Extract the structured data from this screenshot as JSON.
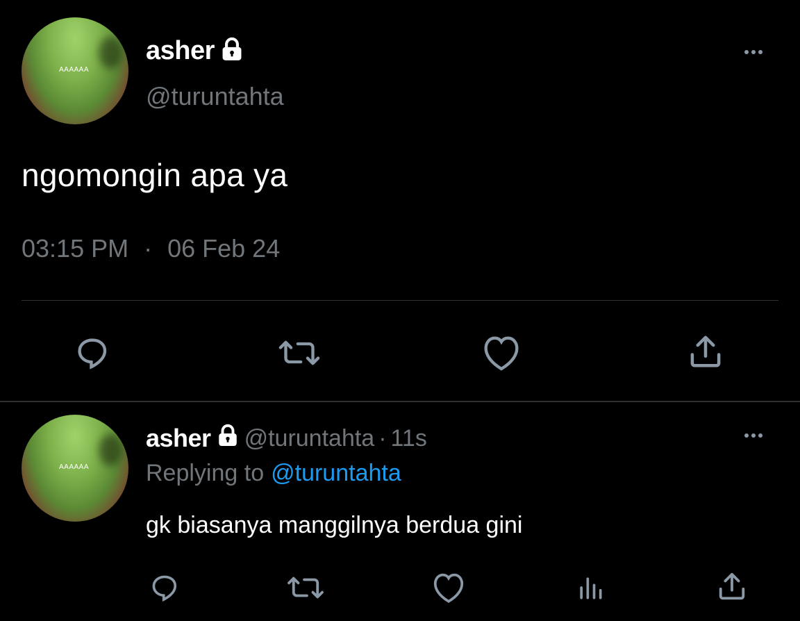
{
  "tweet": {
    "avatar_tag": "AAAAAA",
    "display_name": "asher",
    "handle": "@turuntahta",
    "text": "ngomongin apa ya",
    "time": "03:15 PM",
    "separator": "·",
    "date": "06 Feb 24"
  },
  "reply": {
    "avatar_tag": "AAAAAA",
    "display_name": "asher",
    "handle": "@turuntahta",
    "dot": "·",
    "age": "11s",
    "replying_prefix": "Replying to",
    "replying_handle": "@turuntahta",
    "text": "gk biasanya manggilnya berdua gini"
  },
  "colors": {
    "background": "#000000",
    "muted": "#71767b",
    "link": "#1d9bf0",
    "icon": "#8b98a5",
    "divider": "#2f3336"
  },
  "icons": {
    "more": "more-horizontal-icon",
    "lock": "lock-icon",
    "reply": "comment-icon",
    "retweet": "retweet-icon",
    "like": "heart-icon",
    "share": "share-icon",
    "views": "analytics-icon"
  }
}
